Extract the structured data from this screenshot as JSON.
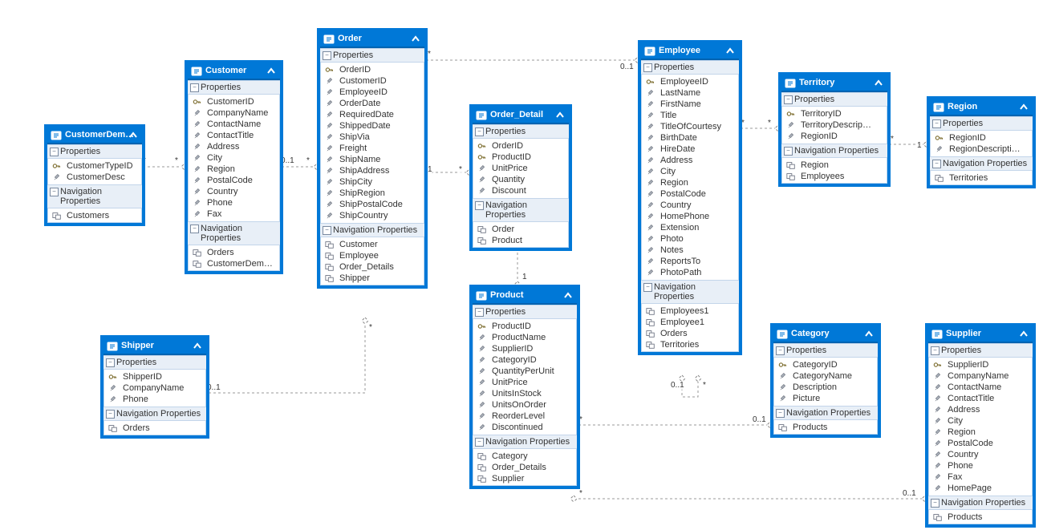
{
  "labels": {
    "properties": "Properties",
    "navprops": "Navigation Properties"
  },
  "entities": {
    "custdemo": {
      "title": "CustomerDem…",
      "props": [
        "CustomerTypeID",
        "CustomerDesc"
      ],
      "nav": [
        "Customers"
      ]
    },
    "customer": {
      "title": "Customer",
      "props": [
        "CustomerID",
        "CompanyName",
        "ContactName",
        "ContactTitle",
        "Address",
        "City",
        "Region",
        "PostalCode",
        "Country",
        "Phone",
        "Fax"
      ],
      "nav": [
        "Orders",
        "CustomerDemo…"
      ]
    },
    "order": {
      "title": "Order",
      "props": [
        "OrderID",
        "CustomerID",
        "EmployeeID",
        "OrderDate",
        "RequiredDate",
        "ShippedDate",
        "ShipVia",
        "Freight",
        "ShipName",
        "ShipAddress",
        "ShipCity",
        "ShipRegion",
        "ShipPostalCode",
        "ShipCountry"
      ],
      "nav": [
        "Customer",
        "Employee",
        "Order_Details",
        "Shipper"
      ]
    },
    "orderdetail": {
      "title": "Order_Detail",
      "props": [
        "OrderID",
        "ProductID",
        "UnitPrice",
        "Quantity",
        "Discount"
      ],
      "nav": [
        "Order",
        "Product"
      ]
    },
    "employee": {
      "title": "Employee",
      "props": [
        "EmployeeID",
        "LastName",
        "FirstName",
        "Title",
        "TitleOfCourtesy",
        "BirthDate",
        "HireDate",
        "Address",
        "City",
        "Region",
        "PostalCode",
        "Country",
        "HomePhone",
        "Extension",
        "Photo",
        "Notes",
        "ReportsTo",
        "PhotoPath"
      ],
      "nav": [
        "Employees1",
        "Employee1",
        "Orders",
        "Territories"
      ]
    },
    "territory": {
      "title": "Territory",
      "props": [
        "TerritoryID",
        "TerritoryDescrip…",
        "RegionID"
      ],
      "nav": [
        "Region",
        "Employees"
      ]
    },
    "region": {
      "title": "Region",
      "props": [
        "RegionID",
        "RegionDescripti…"
      ],
      "nav": [
        "Territories"
      ]
    },
    "shipper": {
      "title": "Shipper",
      "props": [
        "ShipperID",
        "CompanyName",
        "Phone"
      ],
      "nav": [
        "Orders"
      ]
    },
    "product": {
      "title": "Product",
      "props": [
        "ProductID",
        "ProductName",
        "SupplierID",
        "CategoryID",
        "QuantityPerUnit",
        "UnitPrice",
        "UnitsInStock",
        "UnitsOnOrder",
        "ReorderLevel",
        "Discontinued"
      ],
      "nav": [
        "Category",
        "Order_Details",
        "Supplier"
      ]
    },
    "category": {
      "title": "Category",
      "props": [
        "CategoryID",
        "CategoryName",
        "Description",
        "Picture"
      ],
      "nav": [
        "Products"
      ]
    },
    "supplier": {
      "title": "Supplier",
      "props": [
        "SupplierID",
        "CompanyName",
        "ContactName",
        "ContactTitle",
        "Address",
        "City",
        "Region",
        "PostalCode",
        "Country",
        "Phone",
        "Fax",
        "HomePage"
      ],
      "nav": [
        "Products"
      ]
    }
  },
  "cardinalities": {
    "custdemo_customer_many": "*",
    "custdemo_customer_many2": "*",
    "customer_order_01": "0..1",
    "customer_order_many": "*",
    "order_orderdetail_1": "1",
    "order_orderdetail_many": "*",
    "orderdetail_product_many": "*",
    "orderdetail_product_1": "1",
    "order_employee_many": "*",
    "order_employee_01": "0..1",
    "employee_self_01": "0..1",
    "employee_self_many": "*",
    "employee_territory_many": "*",
    "employee_territory_many2": "*",
    "territory_region_many": "*",
    "territory_region_1": "1",
    "order_shipper_many": "*",
    "order_shipper_01": "0..1",
    "product_category_many": "*",
    "product_category_01": "0..1",
    "product_supplier_many": "*",
    "product_supplier_01": "0..1"
  },
  "chart_data": {
    "type": "er-diagram",
    "entities": [
      {
        "name": "CustomerDemographic",
        "properties": [
          "CustomerTypeID",
          "CustomerDesc"
        ],
        "navigation": [
          "Customers"
        ]
      },
      {
        "name": "Customer",
        "properties": [
          "CustomerID",
          "CompanyName",
          "ContactName",
          "ContactTitle",
          "Address",
          "City",
          "Region",
          "PostalCode",
          "Country",
          "Phone",
          "Fax"
        ],
        "navigation": [
          "Orders",
          "CustomerDemographics"
        ]
      },
      {
        "name": "Order",
        "properties": [
          "OrderID",
          "CustomerID",
          "EmployeeID",
          "OrderDate",
          "RequiredDate",
          "ShippedDate",
          "ShipVia",
          "Freight",
          "ShipName",
          "ShipAddress",
          "ShipCity",
          "ShipRegion",
          "ShipPostalCode",
          "ShipCountry"
        ],
        "navigation": [
          "Customer",
          "Employee",
          "Order_Details",
          "Shipper"
        ]
      },
      {
        "name": "Order_Detail",
        "properties": [
          "OrderID",
          "ProductID",
          "UnitPrice",
          "Quantity",
          "Discount"
        ],
        "navigation": [
          "Order",
          "Product"
        ]
      },
      {
        "name": "Employee",
        "properties": [
          "EmployeeID",
          "LastName",
          "FirstName",
          "Title",
          "TitleOfCourtesy",
          "BirthDate",
          "HireDate",
          "Address",
          "City",
          "Region",
          "PostalCode",
          "Country",
          "HomePhone",
          "Extension",
          "Photo",
          "Notes",
          "ReportsTo",
          "PhotoPath"
        ],
        "navigation": [
          "Employees1",
          "Employee1",
          "Orders",
          "Territories"
        ]
      },
      {
        "name": "Territory",
        "properties": [
          "TerritoryID",
          "TerritoryDescription",
          "RegionID"
        ],
        "navigation": [
          "Region",
          "Employees"
        ]
      },
      {
        "name": "Region",
        "properties": [
          "RegionID",
          "RegionDescription"
        ],
        "navigation": [
          "Territories"
        ]
      },
      {
        "name": "Shipper",
        "properties": [
          "ShipperID",
          "CompanyName",
          "Phone"
        ],
        "navigation": [
          "Orders"
        ]
      },
      {
        "name": "Product",
        "properties": [
          "ProductID",
          "ProductName",
          "SupplierID",
          "CategoryID",
          "QuantityPerUnit",
          "UnitPrice",
          "UnitsInStock",
          "UnitsOnOrder",
          "ReorderLevel",
          "Discontinued"
        ],
        "navigation": [
          "Category",
          "Order_Details",
          "Supplier"
        ]
      },
      {
        "name": "Category",
        "properties": [
          "CategoryID",
          "CategoryName",
          "Description",
          "Picture"
        ],
        "navigation": [
          "Products"
        ]
      },
      {
        "name": "Supplier",
        "properties": [
          "SupplierID",
          "CompanyName",
          "ContactName",
          "ContactTitle",
          "Address",
          "City",
          "Region",
          "PostalCode",
          "Country",
          "Phone",
          "Fax",
          "HomePage"
        ],
        "navigation": [
          "Products"
        ]
      }
    ],
    "relationships": [
      {
        "from": "CustomerDemographic",
        "to": "Customer",
        "from_card": "*",
        "to_card": "*"
      },
      {
        "from": "Customer",
        "to": "Order",
        "from_card": "0..1",
        "to_card": "*"
      },
      {
        "from": "Order",
        "to": "Order_Detail",
        "from_card": "1",
        "to_card": "*"
      },
      {
        "from": "Order_Detail",
        "to": "Product",
        "from_card": "*",
        "to_card": "1"
      },
      {
        "from": "Order",
        "to": "Employee",
        "from_card": "*",
        "to_card": "0..1"
      },
      {
        "from": "Employee",
        "to": "Employee",
        "from_card": "0..1",
        "to_card": "*",
        "self": true,
        "via": "ReportsTo"
      },
      {
        "from": "Employee",
        "to": "Territory",
        "from_card": "*",
        "to_card": "*"
      },
      {
        "from": "Territory",
        "to": "Region",
        "from_card": "*",
        "to_card": "1"
      },
      {
        "from": "Order",
        "to": "Shipper",
        "from_card": "*",
        "to_card": "0..1"
      },
      {
        "from": "Product",
        "to": "Category",
        "from_card": "*",
        "to_card": "0..1"
      },
      {
        "from": "Product",
        "to": "Supplier",
        "from_card": "*",
        "to_card": "0..1"
      }
    ]
  }
}
